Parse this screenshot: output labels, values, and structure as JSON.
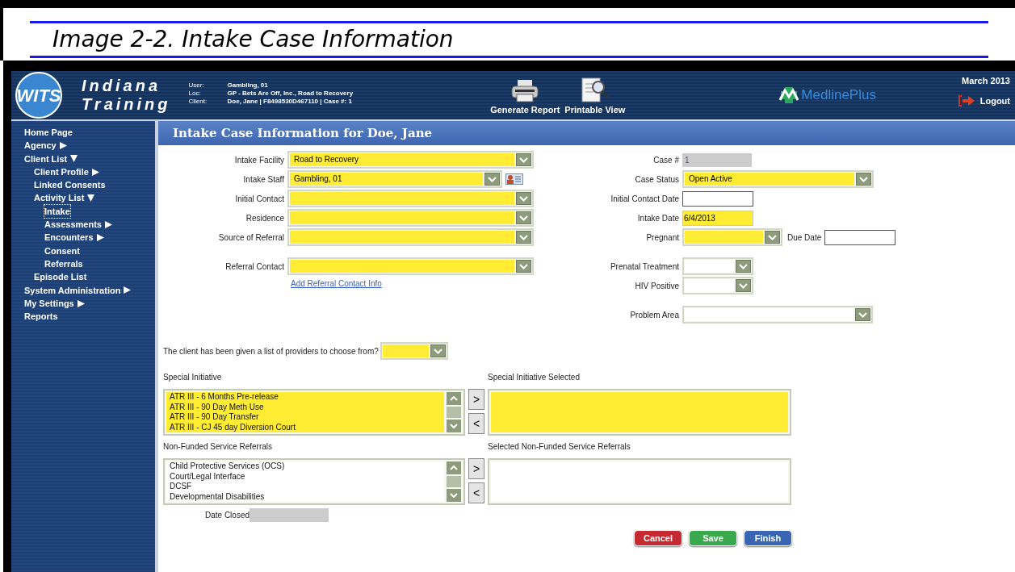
{
  "caption": "Image 2-2. Intake Case Information",
  "header": {
    "logo": "WITS",
    "app_name_lines": [
      "Indiana",
      "Training"
    ],
    "info": [
      {
        "label": "User:",
        "value": "Gambling, 01"
      },
      {
        "label": "Loc:",
        "value": "GP - Bets Are Off, Inc., Road to Recovery"
      },
      {
        "label": "Client:",
        "value": "Doe, Jane | F8498530D467110 | Case #: 1"
      }
    ],
    "actions": [
      {
        "kind": "printer",
        "label": "Generate Report"
      },
      {
        "kind": "document",
        "label": "Printable View"
      }
    ],
    "partner_logo": "MedlinePlus",
    "date": "March 2013",
    "logout": "Logout"
  },
  "sidebar": {
    "items": [
      {
        "label": "Home Page",
        "selected": false
      },
      {
        "label": "Agency",
        "selected": false,
        "expanded": false
      },
      {
        "label": "Client List",
        "selected": false,
        "expanded": true,
        "children": [
          {
            "label": "Client Profile",
            "selected": false,
            "expanded": false
          },
          {
            "label": "Linked Consents",
            "selected": false
          },
          {
            "label": "Activity List",
            "selected": false,
            "expanded": true,
            "children": [
              {
                "label": "Intake",
                "selected": true
              },
              {
                "label": "Assessments",
                "selected": false,
                "expanded": false
              },
              {
                "label": "Encounters",
                "selected": false,
                "expanded": false
              },
              {
                "label": "Consent",
                "selected": false
              },
              {
                "label": "Referrals",
                "selected": false
              }
            ]
          },
          {
            "label": "Episode List",
            "selected": false
          }
        ]
      },
      {
        "label": "System Administration",
        "selected": false,
        "expanded": false
      },
      {
        "label": "My Settings",
        "selected": false,
        "expanded": false
      },
      {
        "label": "Reports",
        "selected": false
      }
    ]
  },
  "form": {
    "title": "Intake Case Information for Doe, Jane",
    "left_groups": [
      [
        {
          "label": "Intake Facility",
          "kind": "select",
          "value": "Road to Recovery",
          "required": true
        },
        {
          "label": "Intake Staff",
          "kind": "select_lookup",
          "value": "Gambling, 01",
          "required": true
        },
        {
          "label": "Initial Contact",
          "kind": "select",
          "required": true
        },
        {
          "label": "Residence",
          "kind": "select",
          "required": true
        },
        {
          "label": "Source of Referral",
          "kind": "select",
          "required": true
        }
      ],
      [
        {
          "label": "Referral Contact",
          "kind": "select",
          "required": true,
          "link": "Add Referral Contact Info"
        }
      ]
    ],
    "right_groups": [
      [
        {
          "label": "Case #",
          "kind": "readonly",
          "value": "1",
          "required": false
        },
        {
          "label": "Case Status",
          "kind": "select_wide",
          "value": "Open Active",
          "required": true
        },
        {
          "label": "Initial Contact Date",
          "kind": "text",
          "required": false
        },
        {
          "label": "Intake Date",
          "kind": "text",
          "value": "6/4/2013",
          "required": true
        },
        {
          "label": "Pregnant",
          "kind": "select_short",
          "required": true,
          "companion": {
            "label": "Due Date",
            "kind": "text",
            "required": false
          }
        }
      ],
      [
        {
          "label": "Prenatal Treatment",
          "kind": "select_tiny",
          "required": false
        },
        {
          "label": "HIV Positive",
          "kind": "select_tiny",
          "required": false
        }
      ],
      [
        {
          "label": "Problem Area",
          "kind": "select_medium",
          "required": false
        }
      ]
    ],
    "question": {
      "label": "The client has been given a list of providers to choose from?",
      "kind": "select_mini",
      "required": true
    },
    "pickers": [
      {
        "label": "Special Initiative",
        "selected_label": "Special Initiative Selected",
        "required": true,
        "options": [
          "ATR III - 6 Months Pre-release",
          "ATR III - 90 Day Meth Use",
          "ATR III - 90 Day Transfer",
          "ATR III - CJ 45 day Diversion Court"
        ],
        "move_right": ">",
        "move_left": "<"
      },
      {
        "label": "Non-Funded Service Referrals",
        "selected_label": "Selected Non-Funded Service Referrals",
        "required": false,
        "options": [
          "Child Protective Services (OCS)",
          "Court/Legal Interface",
          "DCSF",
          "Developmental Disabilities"
        ],
        "move_right": ">",
        "move_left": "<"
      }
    ],
    "date_closed": {
      "label": "Date Closed",
      "kind": "readonly",
      "required": false
    },
    "buttons": [
      {
        "label": "Cancel",
        "color": "#c42a30"
      },
      {
        "label": "Save",
        "color": "#3aa84c"
      },
      {
        "label": "Finish",
        "color": "#3866b4"
      }
    ]
  }
}
